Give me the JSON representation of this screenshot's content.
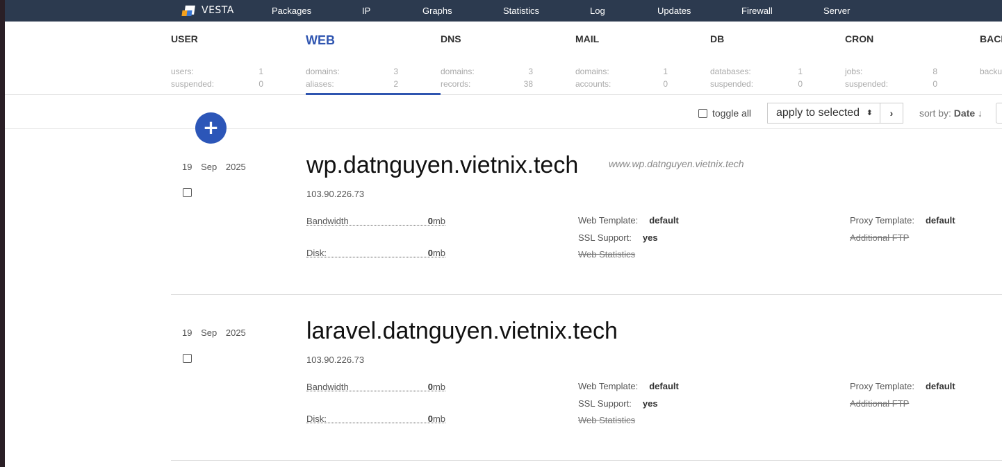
{
  "nav": {
    "logo_text": "VESTA",
    "items": [
      "Packages",
      "IP",
      "Graphs",
      "Statistics",
      "Log",
      "Updates",
      "Firewall",
      "Server"
    ]
  },
  "stats": [
    {
      "title": "USER",
      "rows": [
        {
          "label": "users:",
          "value": "1"
        },
        {
          "label": "suspended:",
          "value": "0"
        }
      ]
    },
    {
      "title": "WEB",
      "active": true,
      "rows": [
        {
          "label": "domains:",
          "value": "3"
        },
        {
          "label": "aliases:",
          "value": "2"
        }
      ]
    },
    {
      "title": "DNS",
      "rows": [
        {
          "label": "domains:",
          "value": "3"
        },
        {
          "label": "records:",
          "value": "38"
        }
      ]
    },
    {
      "title": "MAIL",
      "rows": [
        {
          "label": "domains:",
          "value": "1"
        },
        {
          "label": "accounts:",
          "value": "0"
        }
      ]
    },
    {
      "title": "DB",
      "rows": [
        {
          "label": "databases:",
          "value": "1"
        },
        {
          "label": "suspended:",
          "value": "0"
        }
      ]
    },
    {
      "title": "CRON",
      "rows": [
        {
          "label": "jobs:",
          "value": "8"
        },
        {
          "label": "suspended:",
          "value": "0"
        }
      ]
    },
    {
      "title": "BACKUP",
      "rows": [
        {
          "label": "backups:",
          "value": ""
        },
        {
          "label": "",
          "value": ""
        }
      ]
    }
  ],
  "toolbar": {
    "add_symbol": "+",
    "toggle_all": "toggle all",
    "apply_selected": "apply to selected",
    "apply_arrows": "⬍",
    "go_symbol": "›",
    "sort_label": "sort by:",
    "sort_value": "Date",
    "sort_arrow": "↓"
  },
  "domains": [
    {
      "day": "19",
      "month": "Sep",
      "year": "2025",
      "name": "wp.datnguyen.vietnix.tech",
      "alias": "www.wp.datnguyen.vietnix.tech",
      "ip": "103.90.226.73",
      "bandwidth_label": "Bandwidth",
      "bandwidth_value": "0",
      "bandwidth_unit": "mb",
      "disk_label": "Disk:",
      "disk_value": "0",
      "disk_unit": "mb",
      "web_template_label": "Web Template:",
      "web_template": "default",
      "ssl_label": "SSL Support:",
      "ssl": "yes",
      "web_stats": "Web Statistics",
      "proxy_template_label": "Proxy Template:",
      "proxy_template": "default",
      "additional_ftp": "Additional FTP"
    },
    {
      "day": "19",
      "month": "Sep",
      "year": "2025",
      "name": "laravel.datnguyen.vietnix.tech",
      "alias": "",
      "ip": "103.90.226.73",
      "bandwidth_label": "Bandwidth",
      "bandwidth_value": "0",
      "bandwidth_unit": "mb",
      "disk_label": "Disk:",
      "disk_value": "0",
      "disk_unit": "mb",
      "web_template_label": "Web Template:",
      "web_template": "default",
      "ssl_label": "SSL Support:",
      "ssl": "yes",
      "web_stats": "Web Statistics",
      "proxy_template_label": "Proxy Template:",
      "proxy_template": "default",
      "additional_ftp": "Additional FTP"
    }
  ]
}
